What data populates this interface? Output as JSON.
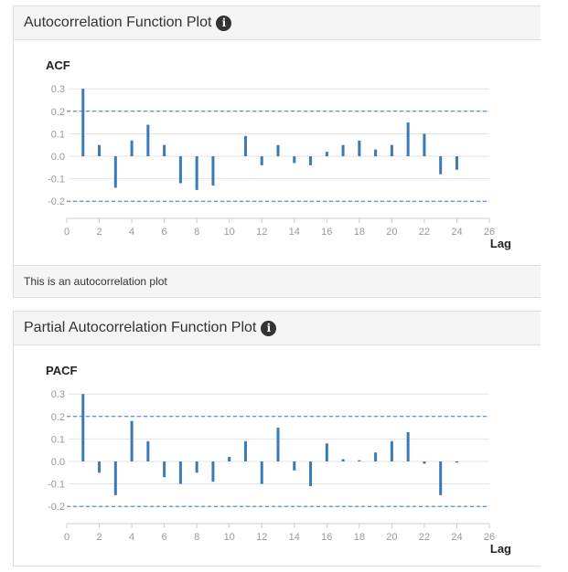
{
  "panels": {
    "acf": {
      "title": "Autocorrelation Function Plot",
      "footer": "This is an autocorrelation plot"
    },
    "pacf": {
      "title": "Partial Autocorrelation Function Plot"
    }
  },
  "icons": {
    "info": "info-icon"
  },
  "colors": {
    "bar": "#3a7ab7",
    "bound": "#3a7ab7",
    "grid": "#e3e3e3",
    "text": "#999999"
  },
  "chart_data": [
    {
      "type": "bar",
      "title": "ACF",
      "xlabel": "Lag",
      "ylabel": "",
      "x": [
        1,
        2,
        3,
        4,
        5,
        6,
        7,
        8,
        9,
        10,
        11,
        12,
        13,
        14,
        15,
        16,
        17,
        18,
        19,
        20,
        21,
        22,
        23,
        24
      ],
      "values": [
        0.3,
        0.05,
        -0.14,
        0.07,
        0.14,
        0.05,
        -0.12,
        -0.15,
        -0.13,
        0,
        0.09,
        -0.04,
        0.05,
        -0.03,
        -0.04,
        0.02,
        0.05,
        0.07,
        0.03,
        0.05,
        0.15,
        0.1,
        -0.08,
        -0.06
      ],
      "confidence_bounds": [
        -0.2,
        0.2
      ],
      "xlim": [
        0,
        26
      ],
      "ylim": [
        -0.25,
        0.3
      ],
      "xticks": [
        0,
        2,
        4,
        6,
        8,
        10,
        12,
        14,
        16,
        18,
        20,
        22,
        24,
        26
      ],
      "yticks": [
        -0.2,
        -0.1,
        0.0,
        0.1,
        0.2,
        0.3
      ],
      "ytick_labels": [
        "-0.2",
        "-0.1",
        "0.0",
        "0.1",
        "0.2",
        "0.3"
      ],
      "grid": true
    },
    {
      "type": "bar",
      "title": "PACF",
      "xlabel": "Lag",
      "ylabel": "",
      "x": [
        1,
        2,
        3,
        4,
        5,
        6,
        7,
        8,
        9,
        10,
        11,
        12,
        13,
        14,
        15,
        16,
        17,
        18,
        19,
        20,
        21,
        22,
        23,
        24
      ],
      "values": [
        0.3,
        -0.05,
        -0.15,
        0.18,
        0.09,
        -0.07,
        -0.1,
        -0.05,
        -0.09,
        0.02,
        0.09,
        -0.1,
        0.15,
        -0.04,
        -0.11,
        0.08,
        0.01,
        0.005,
        0.04,
        0.09,
        0.13,
        -0.01,
        -0.15,
        -0.005
      ],
      "confidence_bounds": [
        -0.2,
        0.2
      ],
      "xlim": [
        0,
        26
      ],
      "ylim": [
        -0.25,
        0.3
      ],
      "xticks": [
        0,
        2,
        4,
        6,
        8,
        10,
        12,
        14,
        16,
        18,
        20,
        22,
        24,
        26
      ],
      "yticks": [
        -0.2,
        -0.1,
        0.0,
        0.1,
        0.2,
        0.3
      ],
      "ytick_labels": [
        "-0.2",
        "-0.1",
        "0.0",
        "0.1",
        "0.2",
        "0.3"
      ],
      "grid": true
    }
  ]
}
